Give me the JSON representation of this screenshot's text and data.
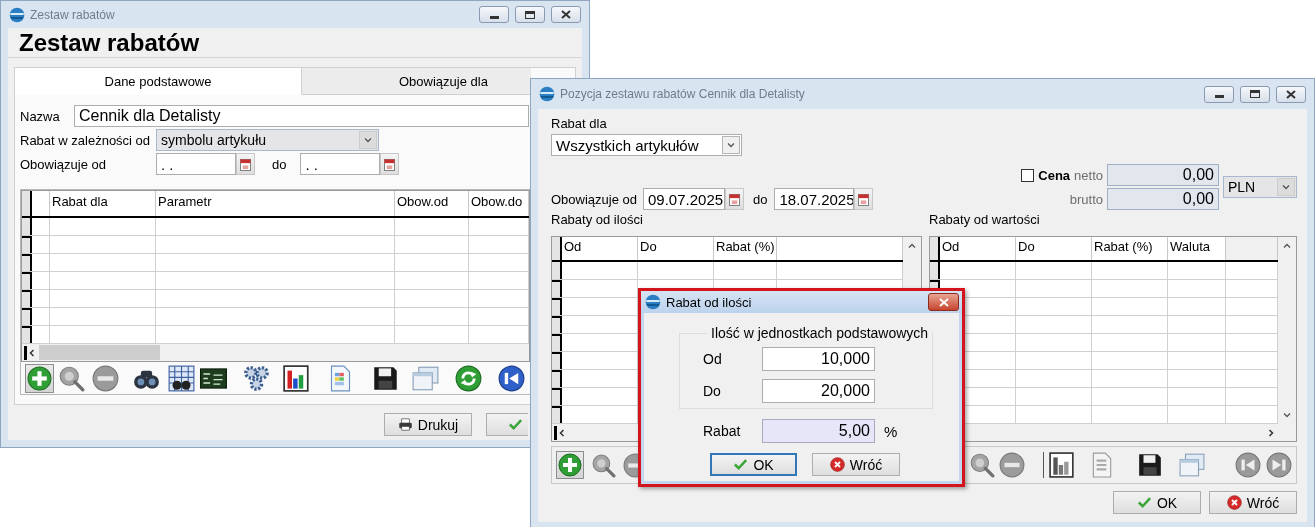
{
  "main_window": {
    "title": "Zestaw rabatów",
    "heading": "Zestaw rabatów",
    "tabs": [
      {
        "label": "Dane podstawowe",
        "selected": true
      },
      {
        "label": "Obowiązuje dla",
        "selected": false
      }
    ],
    "name": {
      "label": "Nazwa",
      "value": "Cennik dla Detalisty"
    },
    "discount_basis": {
      "label": "Rabat w zależności od",
      "value": "symbolu artykułu",
      "disabled": true
    },
    "validity": {
      "label": "Obowiązuje od",
      "from": ". .",
      "to_label": "do",
      "to": ". ."
    },
    "table": {
      "columns": [
        "Rabat dla",
        "Parametr",
        "Obow.od",
        "Obow.do"
      ]
    },
    "buttons": [
      {
        "label": "Drukuj",
        "kind": "print"
      },
      {
        "kind": "ok"
      }
    ]
  },
  "position_window": {
    "title": "Pozycja zestawu rabatów Cennik dla Detalisty",
    "discount_for": {
      "label": "Rabat dla",
      "value": "Wszystkich artykułów"
    },
    "price": {
      "label": "Cena",
      "checked": false,
      "net_label": "netto",
      "net_value": "0,00",
      "gross_label": "brutto",
      "gross_value": "0,00",
      "currency": "PLN",
      "disabled": true
    },
    "validity": {
      "label": "Obowiązuje od",
      "from": "09.07.2025",
      "to_label": "do",
      "to": "18.07.2025"
    },
    "quantity_table": {
      "title": "Rabaty od ilości",
      "columns": [
        "Od",
        "Do",
        "Rabat (%)"
      ]
    },
    "value_table": {
      "title": "Rabaty od wartości",
      "columns": [
        "Od",
        "Do",
        "Rabat (%)",
        "Waluta"
      ]
    },
    "buttons": [
      {
        "label": "OK",
        "kind": "ok"
      },
      {
        "label": "Wróć",
        "kind": "cancel"
      }
    ]
  },
  "dialog": {
    "title": "Rabat od ilości",
    "group_title": "Ilość w jednostkach podstawowych",
    "fields": [
      {
        "label": "Od",
        "value": "10,000"
      },
      {
        "label": "Do",
        "value": "20,000"
      }
    ],
    "discount": {
      "label": "Rabat",
      "value": "5,00",
      "unit": "%"
    },
    "buttons": [
      {
        "label": "OK",
        "kind": "ok",
        "focused": true
      },
      {
        "label": "Wróć",
        "kind": "cancel",
        "focused": false
      }
    ]
  }
}
